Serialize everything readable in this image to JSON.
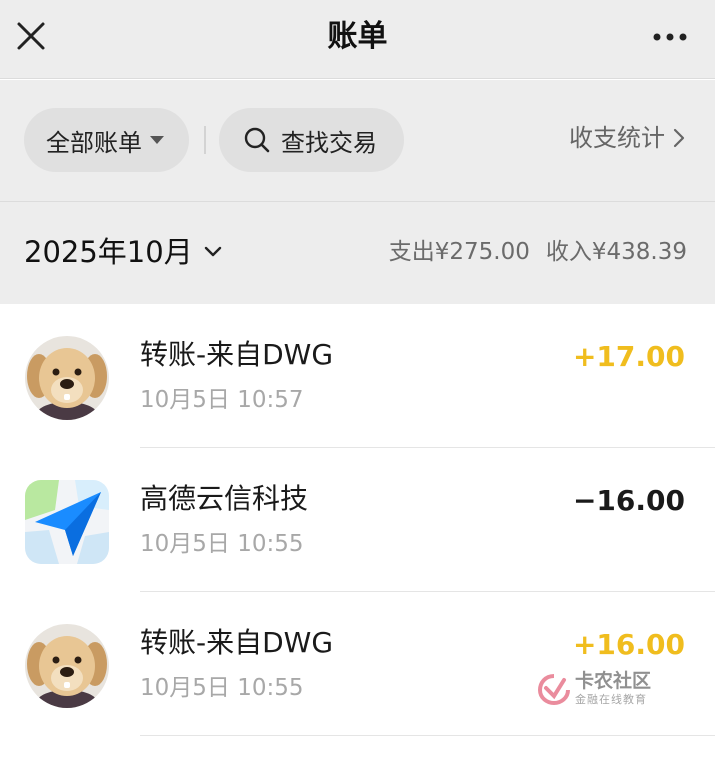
{
  "header": {
    "title": "账单",
    "close_icon": "close-icon",
    "more_icon": "more-icon"
  },
  "filters": {
    "all_bills_label": "全部账单",
    "search_label": "查找交易",
    "stats_label": "收支统计"
  },
  "month_bar": {
    "month_label": "2025年10月",
    "expense_summary": "支出¥275.00",
    "income_summary": "收入¥438.39"
  },
  "transactions": [
    {
      "name": "转账-来自DWG",
      "time": "10月5日 10:57",
      "amount": "+17.00",
      "type": "income",
      "avatar": "dog-avatar"
    },
    {
      "name": "高德云信科技",
      "time": "10月5日 10:55",
      "amount": "−16.00",
      "type": "expense",
      "avatar": "amap-logo"
    },
    {
      "name": "转账-来自DWG",
      "time": "10月5日 10:55",
      "amount": "+16.00",
      "type": "income",
      "avatar": "dog-avatar"
    }
  ],
  "watermark": {
    "title": "卡农社区",
    "subtitle": "金融在线教育"
  },
  "colors": {
    "income": "#f0bd1e",
    "expense": "#1a1a1a",
    "header_bg": "#ededed",
    "pill_bg": "#e0e0e0"
  }
}
